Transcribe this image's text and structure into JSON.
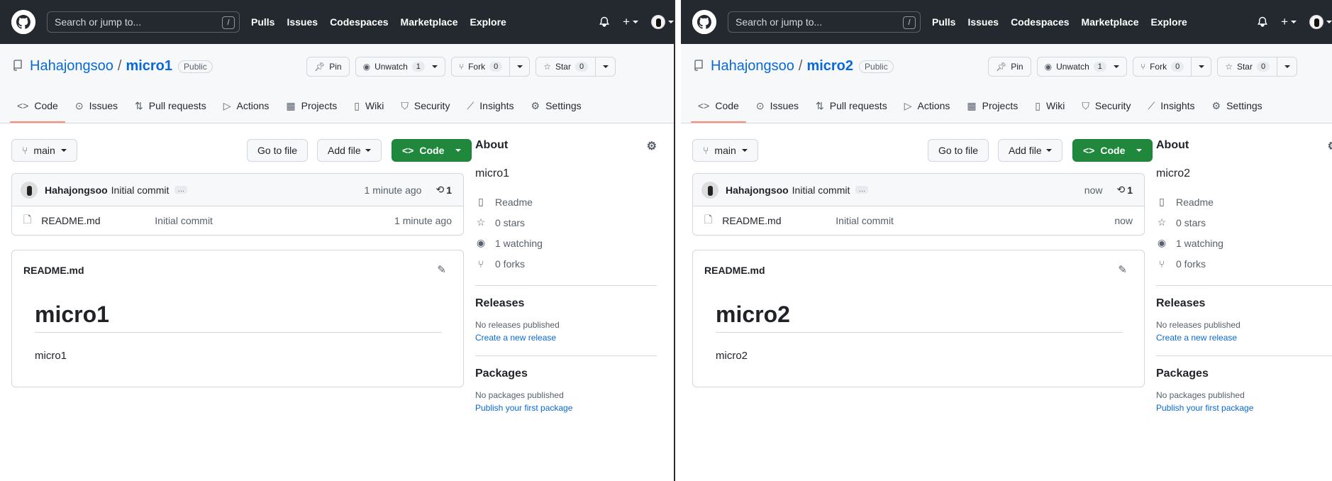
{
  "header": {
    "search_placeholder": "Search or jump to...",
    "slash_key": "/",
    "nav": [
      "Pulls",
      "Issues",
      "Codespaces",
      "Marketplace",
      "Explore"
    ],
    "plus_label": "+"
  },
  "tabs": [
    "Code",
    "Issues",
    "Pull requests",
    "Actions",
    "Projects",
    "Wiki",
    "Security",
    "Insights",
    "Settings"
  ],
  "actions": {
    "pin": "Pin",
    "unwatch": "Unwatch",
    "unwatch_count": "1",
    "fork": "Fork",
    "fork_count": "0",
    "star": "Star",
    "star_count": "0"
  },
  "buttons": {
    "branch": "main",
    "go_to_file": "Go to file",
    "add_file": "Add file",
    "code": "Code"
  },
  "panes": [
    {
      "owner": "Hahajongsoo",
      "repo": "micro1",
      "visibility": "Public",
      "commit": {
        "author": "Hahajongsoo",
        "message": "Initial commit",
        "ellipsis": "…",
        "time": "1 minute ago",
        "history_count": "1"
      },
      "file": {
        "name": "README.md",
        "message": "Initial commit",
        "time": "1 minute ago"
      },
      "readme": {
        "filename": "README.md",
        "heading": "micro1",
        "text": "micro1"
      },
      "about": {
        "title": "About",
        "description": "micro1",
        "readme": "Readme",
        "stars": "0 stars",
        "watching": "1 watching",
        "forks": "0 forks"
      },
      "releases": {
        "title": "Releases",
        "none": "No releases published",
        "link": "Create a new release"
      },
      "packages": {
        "title": "Packages",
        "none": "No packages published",
        "link": "Publish your first package"
      }
    },
    {
      "owner": "Hahajongsoo",
      "repo": "micro2",
      "visibility": "Public",
      "commit": {
        "author": "Hahajongsoo",
        "message": "Initial commit",
        "ellipsis": "…",
        "time": "now",
        "history_count": "1"
      },
      "file": {
        "name": "README.md",
        "message": "Initial commit",
        "time": "now"
      },
      "readme": {
        "filename": "README.md",
        "heading": "micro2",
        "text": "micro2"
      },
      "about": {
        "title": "About",
        "description": "micro2",
        "readme": "Readme",
        "stars": "0 stars",
        "watching": "1 watching",
        "forks": "0 forks"
      },
      "releases": {
        "title": "Releases",
        "none": "No releases published",
        "link": "Create a new release"
      },
      "packages": {
        "title": "Packages",
        "none": "No packages published",
        "link": "Publish your first package"
      }
    }
  ]
}
